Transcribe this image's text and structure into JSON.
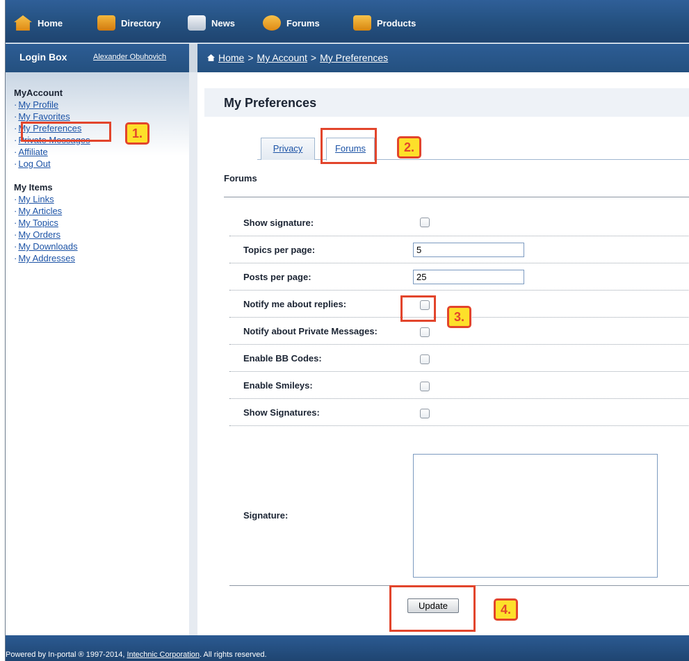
{
  "top_nav": {
    "items": [
      {
        "label": "Home",
        "icon": "home-icon"
      },
      {
        "label": "Directory",
        "icon": "directory-icon"
      },
      {
        "label": "News",
        "icon": "news-icon"
      },
      {
        "label": "Forums",
        "icon": "forums-icon"
      },
      {
        "label": "Products",
        "icon": "products-icon"
      }
    ]
  },
  "login_box": {
    "title": "Login Box",
    "user": "Alexander Obuhovich"
  },
  "breadcrumb": {
    "items": [
      "Home",
      "My Account",
      "My Preferences"
    ],
    "separator": ">"
  },
  "sidebar": {
    "my_account_title": "MyAccount",
    "my_account_links": [
      "My Profile",
      "My Favorites",
      "My Preferences",
      "Private Messages",
      "Affiliate",
      "Log Out"
    ],
    "my_items_title": "My Items",
    "my_items_links": [
      "My Links",
      "My Articles",
      "My Topics",
      "My Orders",
      "My Downloads",
      "My Addresses"
    ]
  },
  "page": {
    "title": "My Preferences",
    "tabs": [
      "Privacy",
      "Forums"
    ],
    "active_tab": "Forums",
    "section_title": "Forums"
  },
  "form": {
    "show_signature_label": "Show signature:",
    "topics_per_page_label": "Topics per page:",
    "topics_per_page_value": "5",
    "posts_per_page_label": "Posts per page:",
    "posts_per_page_value": "25",
    "notify_replies_label": "Notify me about replies:",
    "notify_pm_label": "Notify about Private Messages:",
    "enable_bb_label": "Enable BB Codes:",
    "enable_smileys_label": "Enable Smileys:",
    "show_signatures_label": "Show Signatures:",
    "signature_label": "Signature:",
    "signature_value": "",
    "update_label": "Update"
  },
  "annotations": {
    "step1": "1.",
    "step2": "2.",
    "step3": "3.",
    "step4": "4."
  },
  "footer": {
    "prefix": "Powered by In-portal ® 1997-2014, ",
    "company": "Intechnic Corporation",
    "suffix": ". All rights reserved."
  },
  "colors": {
    "nav_blue": "#24507f",
    "link_blue": "#1c53a6",
    "highlight_red": "#e2452c",
    "step_yellow": "#fde02a"
  }
}
